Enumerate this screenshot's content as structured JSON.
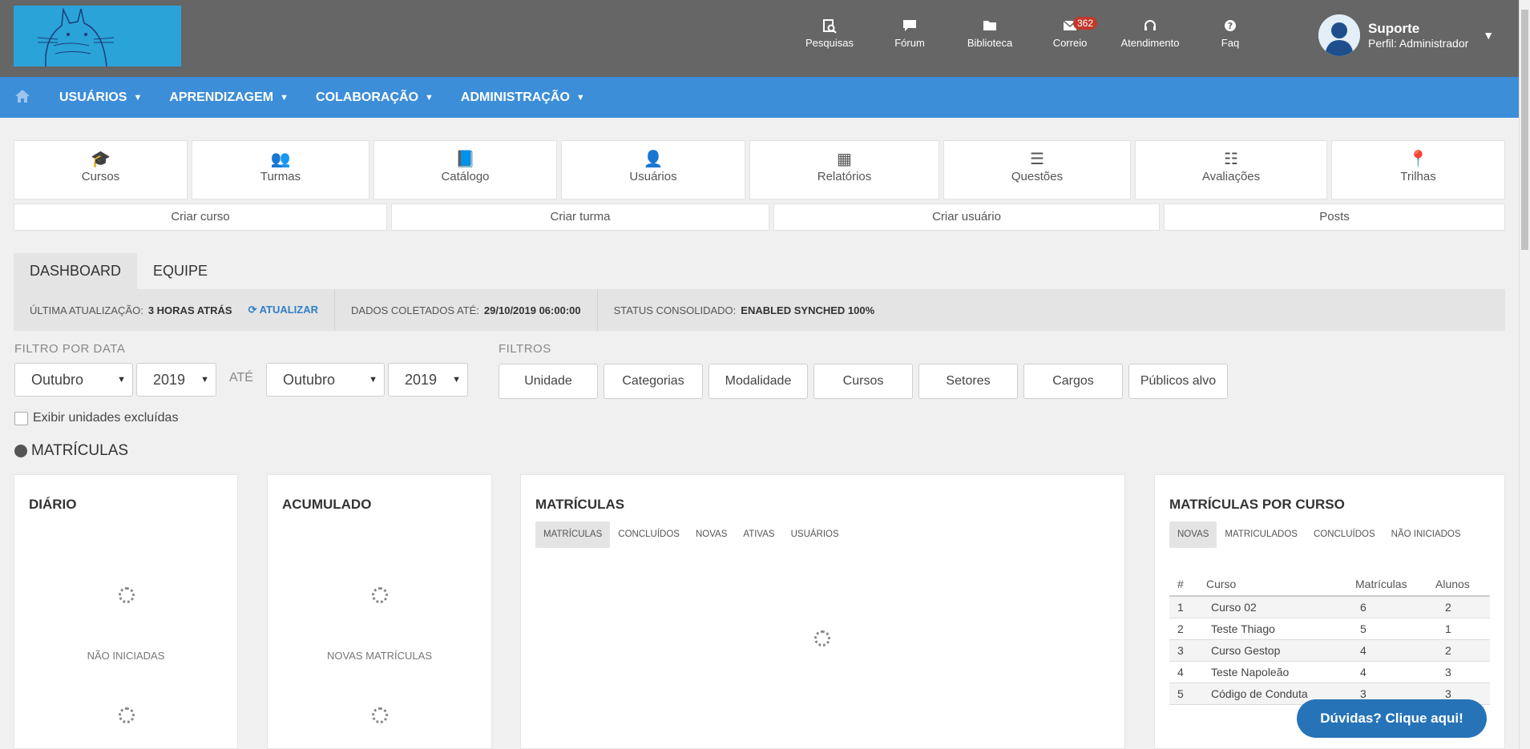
{
  "header": {
    "top_icons": [
      {
        "label": "Pesquisas",
        "icon": "search-document-icon"
      },
      {
        "label": "Fórum",
        "icon": "chat-icon"
      },
      {
        "label": "Biblioteca",
        "icon": "folder-icon"
      },
      {
        "label": "Correio",
        "icon": "mail-icon",
        "badge": "362"
      },
      {
        "label": "Atendimento",
        "icon": "headset-icon"
      },
      {
        "label": "Faq",
        "icon": "question-icon"
      }
    ],
    "user": {
      "name": "Suporte",
      "role": "Perfil: Administrador"
    }
  },
  "nav": {
    "items": [
      "USUÁRIOS",
      "APRENDIZAGEM",
      "COLABORAÇÃO",
      "ADMINISTRAÇÃO"
    ]
  },
  "tiles": [
    {
      "label": "Cursos",
      "icon": "graduation-cap-icon"
    },
    {
      "label": "Turmas",
      "icon": "users-icon"
    },
    {
      "label": "Catálogo",
      "icon": "book-icon"
    },
    {
      "label": "Usuários",
      "icon": "user-icon"
    },
    {
      "label": "Relatórios",
      "icon": "table-icon"
    },
    {
      "label": "Questões",
      "icon": "list-icon"
    },
    {
      "label": "Avaliações",
      "icon": "ordered-list-icon"
    },
    {
      "label": "Trilhas",
      "icon": "map-marker-icon"
    }
  ],
  "actions": [
    "Criar curso",
    "Criar turma",
    "Criar usuário",
    "Posts"
  ],
  "tabs": [
    "DASHBOARD",
    "EQUIPE"
  ],
  "status": {
    "last_update_label": "ÚLTIMA ATUALIZAÇÃO:",
    "last_update_value": "3 HORAS ATRÁS",
    "refresh_label": "ATUALIZAR",
    "collected_label": "DADOS COLETADOS ATÉ:",
    "collected_value": "29/10/2019 06:00:00",
    "status_label": "STATUS CONSOLIDADO:",
    "status_value": "ENABLED SYNCHED 100%"
  },
  "filters": {
    "date_label": "FILTRO POR DATA",
    "from_month": "Outubro",
    "from_year": "2019",
    "until_label": "ATÉ",
    "to_month": "Outubro",
    "to_year": "2019",
    "filters_label": "FILTROS",
    "buttons": [
      "Unidade",
      "Categorias",
      "Modalidade",
      "Cursos",
      "Setores",
      "Cargos",
      "Públicos alvo"
    ],
    "show_excluded": "Exibir unidades excluídas"
  },
  "section_title": "MATRÍCULAS",
  "cards": {
    "daily": {
      "title": "DIÁRIO",
      "label": "NÃO INICIADAS"
    },
    "accumulated": {
      "title": "ACUMULADO",
      "label": "NOVAS MATRÍCULAS"
    },
    "enrollments": {
      "title": "MATRÍCULAS",
      "tabs": [
        "MATRÍCULAS",
        "CONCLUÍDOS",
        "NOVAS",
        "ATIVAS",
        "USUÁRIOS"
      ]
    },
    "by_course": {
      "title": "MATRÍCULAS POR CURSO",
      "tabs": [
        "NOVAS",
        "MATRICULADOS",
        "CONCLUÍDOS",
        "NÃO INICIADOS"
      ],
      "columns": [
        "#",
        "Curso",
        "Matrículas",
        "Alunos"
      ],
      "rows": [
        [
          "1",
          "Curso 02",
          "6",
          "2"
        ],
        [
          "2",
          "Teste Thiago",
          "5",
          "1"
        ],
        [
          "3",
          "Curso Gestop",
          "4",
          "2"
        ],
        [
          "4",
          "Teste Napoleão",
          "4",
          "3"
        ],
        [
          "5",
          "Código de Conduta",
          "3",
          "3"
        ]
      ]
    }
  },
  "help_button": "Dúvidas? Clique aqui!"
}
